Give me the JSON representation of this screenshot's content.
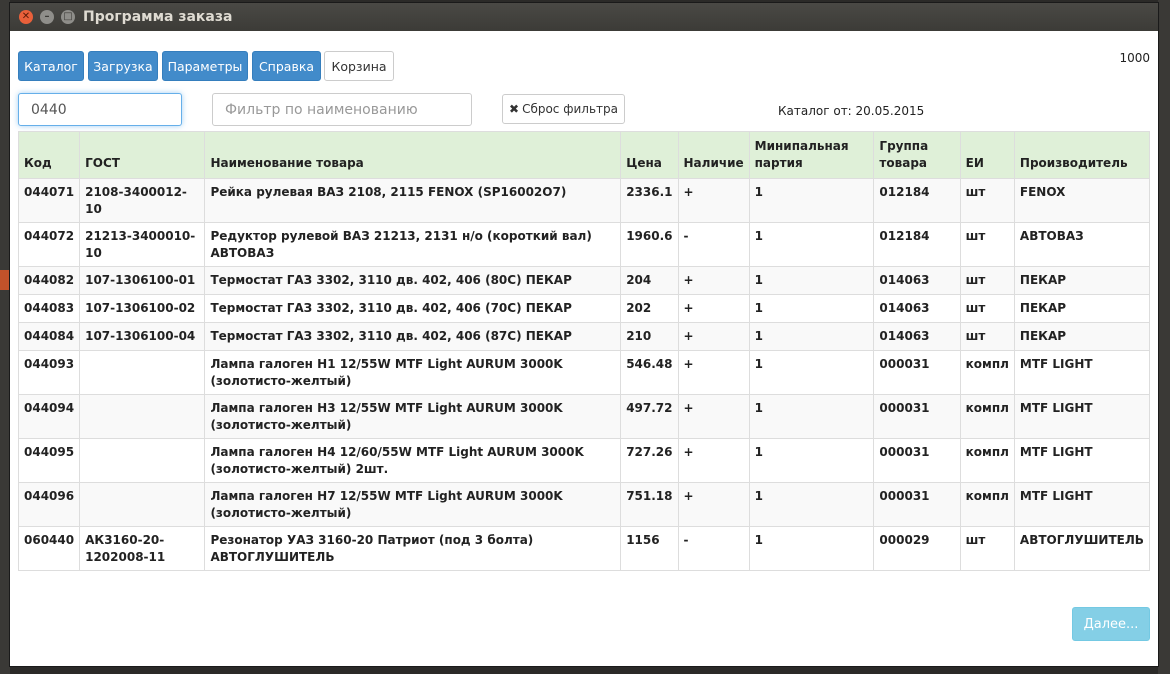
{
  "window": {
    "title": "Программа заказа"
  },
  "tabs": [
    {
      "label": "Каталог"
    },
    {
      "label": "Загрузка"
    },
    {
      "label": "Параметры"
    },
    {
      "label": "Справка"
    },
    {
      "label": "Корзина"
    }
  ],
  "counter": "1000",
  "filters": {
    "code_value": "0440",
    "name_placeholder": "Фильтр по наименованию",
    "reset_label": "Сброс фильтра"
  },
  "catalog_date": "Каталог от: 20.05.2015",
  "table": {
    "headers": [
      "Код",
      "ГОСТ",
      "Наименование товара",
      "Цена",
      "Наличие",
      "Минипальная партия",
      "Группа товара",
      "ЕИ",
      "Производитель"
    ],
    "rows": [
      [
        "044071",
        "2108-3400012-10",
        "Рейка рулевая ВАЗ 2108, 2115 FENOX (SP16002O7)",
        "2336.1",
        "+",
        "1",
        "012184",
        "шт",
        "FENOX"
      ],
      [
        "044072",
        "21213-3400010-10",
        "Редуктор рулевой ВАЗ 21213, 2131 н/о (короткий вал) АВТОВАЗ",
        "1960.6",
        "-",
        "1",
        "012184",
        "шт",
        "АВТОВАЗ"
      ],
      [
        "044082",
        "107-1306100-01",
        "Термостат ГАЗ 3302, 3110 дв. 402, 406 (80С) ПЕКАР",
        "204",
        "+",
        "1",
        "014063",
        "шт",
        "ПЕКАР"
      ],
      [
        "044083",
        "107-1306100-02",
        "Термостат ГАЗ 3302, 3110 дв. 402, 406 (70С) ПЕКАР",
        "202",
        "+",
        "1",
        "014063",
        "шт",
        "ПЕКАР"
      ],
      [
        "044084",
        "107-1306100-04",
        "Термостат ГАЗ 3302, 3110 дв. 402, 406 (87С) ПЕКАР",
        "210",
        "+",
        "1",
        "014063",
        "шт",
        "ПЕКАР"
      ],
      [
        "044093",
        "",
        "Лампа галоген H1 12/55W MTF Light AURUM 3000K (золотисто-желтый)",
        "546.48",
        "+",
        "1",
        "000031",
        "компл",
        "MTF LIGHT"
      ],
      [
        "044094",
        "",
        "Лампа галоген H3 12/55W MTF Light AURUM 3000K (золотисто-желтый)",
        "497.72",
        "+",
        "1",
        "000031",
        "компл",
        "MTF LIGHT"
      ],
      [
        "044095",
        "",
        "Лампа галоген H4 12/60/55W MTF Light AURUM 3000K (золотисто-желтый) 2шт.",
        "727.26",
        "+",
        "1",
        "000031",
        "компл",
        "MTF LIGHT"
      ],
      [
        "044096",
        "",
        "Лампа галоген H7 12/55W MTF Light AURUM 3000K (золотисто-желтый)",
        "751.18",
        "+",
        "1",
        "000031",
        "компл",
        "MTF LIGHT"
      ],
      [
        "060440",
        "АК3160-20-1202008-11",
        "Резонатор УАЗ 3160-20 Патриот (под 3 болта) АВТОГЛУШИТЕЛЬ",
        "1156",
        "-",
        "1",
        "000029",
        "шт",
        "АВТОГЛУШИТЕЛЬ"
      ]
    ]
  },
  "next_label": "Далее..."
}
